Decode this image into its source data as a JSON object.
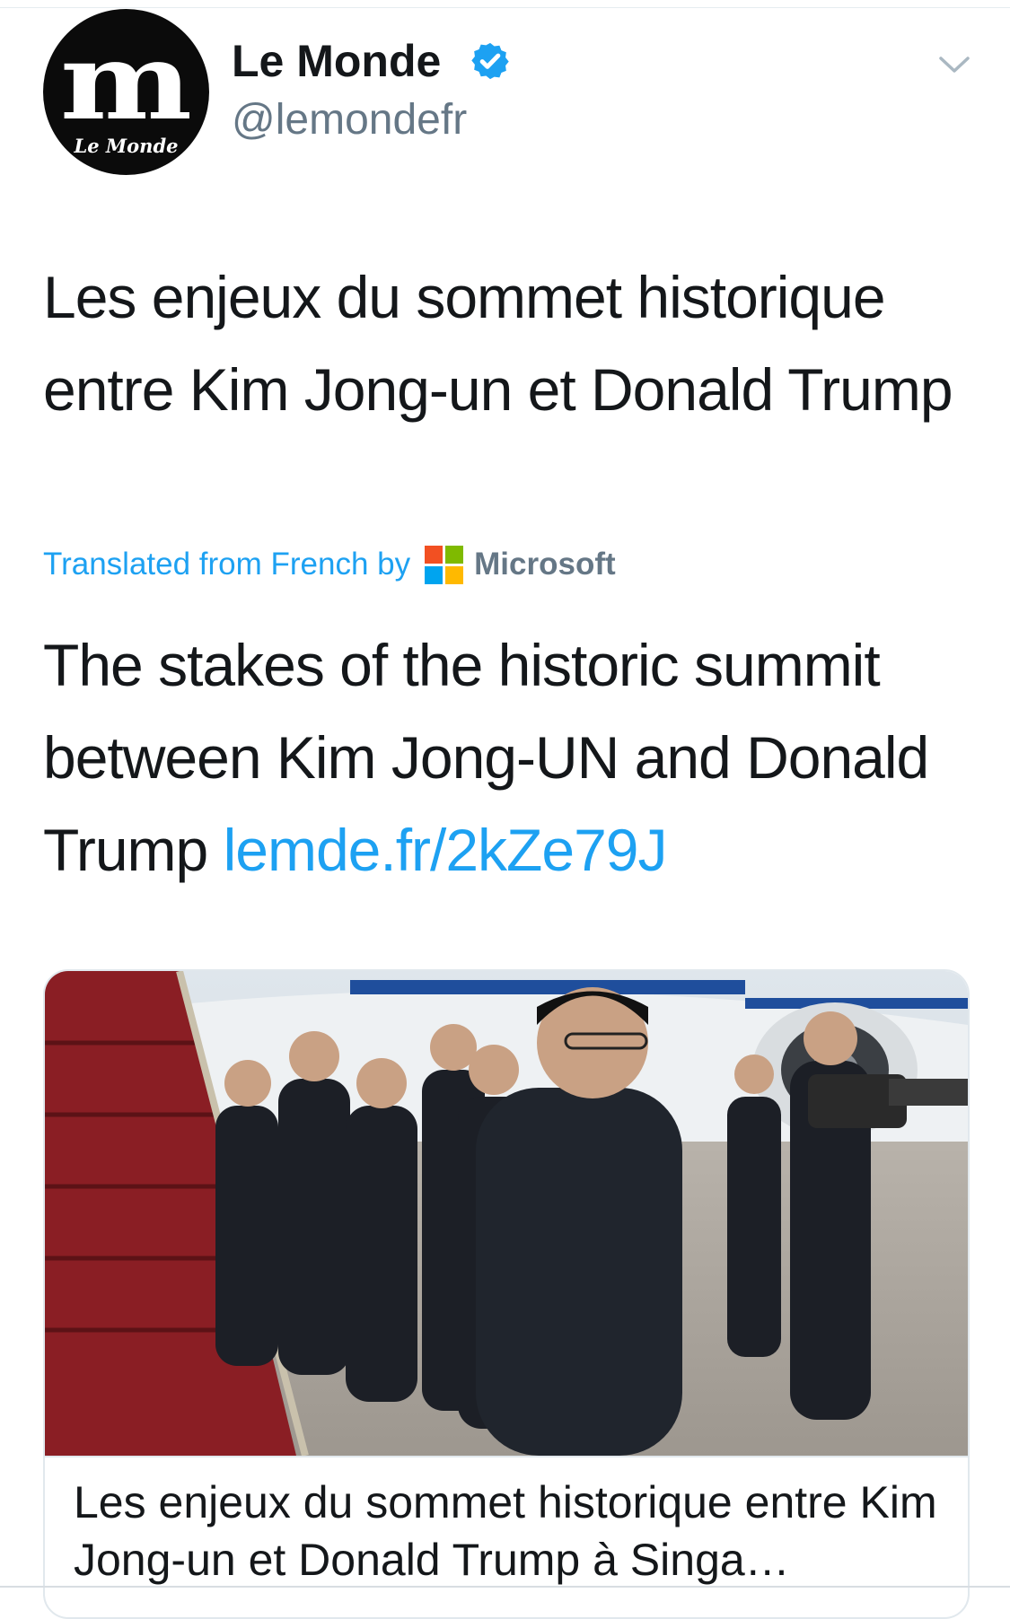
{
  "account": {
    "avatar_letter": "m",
    "avatar_wordmark": "Le Monde",
    "display_name": "Le Monde",
    "handle": "@lemondefr",
    "verified_icon": "verified-badge-icon",
    "menu_icon": "chevron-down-icon"
  },
  "tweet": {
    "text": "Les enjeux du sommet historique entre Kim Jong-un et Donald Trump",
    "translation_label": "Translated from French by",
    "translation_provider": "Microsoft",
    "translated_text": "The stakes of the historic summit between Kim Jong-UN and Donald Trump",
    "link": "lemde.fr/2kZe79J"
  },
  "card": {
    "image_icon": "photo-delegation-airport-image",
    "title": "Les enjeux du sommet historique entre Kim Jong-un et Donald Trump à Singa…"
  },
  "colors": {
    "link_blue": "#1da1f2",
    "text_primary": "#14171a",
    "text_secondary": "#657786",
    "border": "#e1e8ed",
    "ms_red": "#f25022",
    "ms_green": "#7fba00",
    "ms_blue": "#00a4ef",
    "ms_yellow": "#ffb900"
  }
}
